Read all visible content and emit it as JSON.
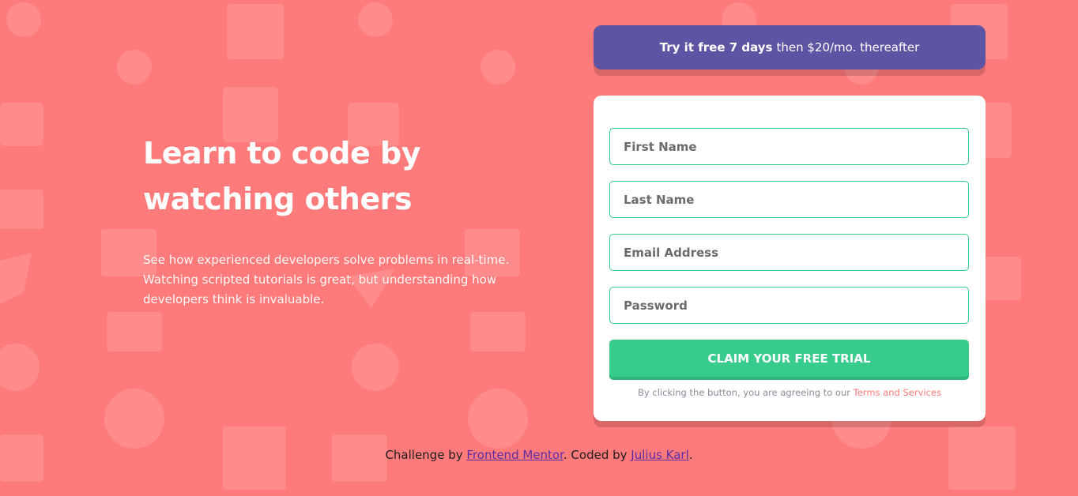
{
  "colors": {
    "background": "#ff7a7a",
    "banner": "#5e54a4",
    "accent_green": "#38cc8c",
    "card": "#ffffff",
    "terms_link": "#ff7a7a",
    "footer_link": "#5e2ca5"
  },
  "hero": {
    "title_line1": "Learn to code by",
    "title_line2": "watching others",
    "description": "See how experienced developers solve problems in real-time. Watching scripted tutorials is great, but understanding how developers think is invaluable."
  },
  "banner": {
    "bold_text": "Try it free 7 days",
    "rest_text": "then $20/mo. thereafter"
  },
  "form": {
    "first_name_placeholder": "First Name",
    "last_name_placeholder": "Last Name",
    "email_placeholder": "Email Address",
    "password_placeholder": "Password",
    "submit_label": "CLAIM YOUR FREE TRIAL",
    "terms_prefix": "By clicking the button, you are agreeing to our",
    "terms_link": "Terms and Services"
  },
  "footer": {
    "prefix": "Challenge by",
    "link1": "Frontend Mentor",
    "middle": ". Coded by",
    "link2": "Julius Karl",
    "suffix": "."
  },
  "background_icons": [
    "support-icon",
    "toolbox-icon",
    "network-icon",
    "thumbs-up-icon",
    "cart-icon",
    "gear-icon",
    "lifebuoy-icon",
    "calendar-icon",
    "rocket-icon",
    "chart-icon",
    "browser-icon"
  ]
}
